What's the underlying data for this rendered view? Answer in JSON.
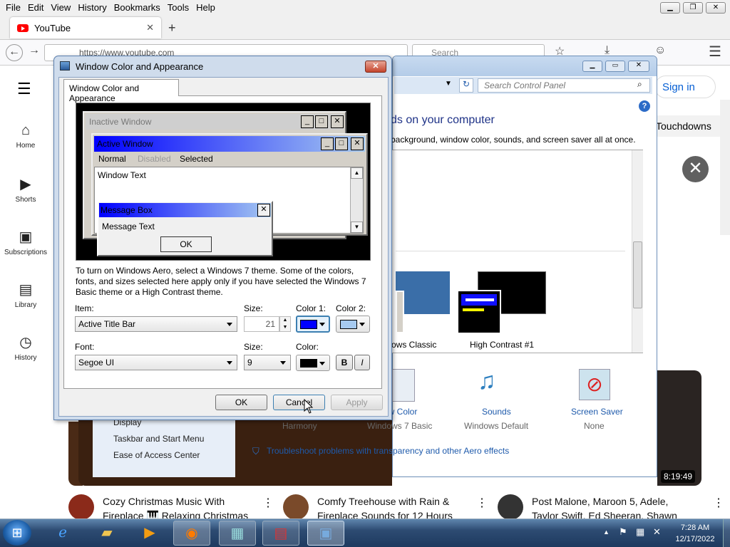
{
  "firefox": {
    "menu": [
      "File",
      "Edit",
      "View",
      "History",
      "Bookmarks",
      "Tools",
      "Help"
    ],
    "tab_title": "YouTube",
    "new_tab": "+",
    "url": "https://www.youtube.com",
    "search_placeholder": "Search"
  },
  "youtube": {
    "sidebar": [
      {
        "label": "Home",
        "icon": "home-icon"
      },
      {
        "label": "Shorts",
        "icon": "shorts-icon"
      },
      {
        "label": "Subscriptions",
        "icon": "subscriptions-icon"
      },
      {
        "label": "Library",
        "icon": "library-icon"
      },
      {
        "label": "History",
        "icon": "history-icon"
      }
    ],
    "sign_in": "Sign in",
    "chip": "Touchdowns",
    "duration": "8:19:49",
    "videos": [
      {
        "title_line1": "Cozy Christmas Music With",
        "title_line2": "Fireplace 🎹 Relaxing Christmas"
      },
      {
        "title_line1": "Comfy Treehouse with Rain &",
        "title_line2": "Fireplace Sounds for 12 Hours"
      },
      {
        "title_line1": "Post Malone, Maroon 5, Adele,",
        "title_line2": "Taylor Swift, Ed Sheeran, Shawn"
      }
    ]
  },
  "control_panel": {
    "search_placeholder": "Search Control Panel",
    "heading": "ds on your computer",
    "subheading": "background, window color, sounds, and screen saver all at once.",
    "themes": [
      {
        "label": "ows Classic"
      },
      {
        "label": "High Contrast #1"
      }
    ],
    "bottom_items": [
      {
        "title": "ow Color",
        "sub": "Windows 7 Basic"
      },
      {
        "title": "Sounds",
        "sub": "Windows Default"
      },
      {
        "title": "Screen Saver",
        "sub": "None"
      }
    ],
    "harmony": "Harmony",
    "see_also": [
      "Display",
      "Taskbar and Start Menu",
      "Ease of Access Center"
    ],
    "troubleshoot": "Troubleshoot problems with transparency and other Aero effects"
  },
  "dialog": {
    "title": "Window Color and Appearance",
    "tab": "Window Color and Appearance",
    "preview": {
      "inactive_title": "Inactive Window",
      "active_title": "Active Window",
      "menu_normal": "Normal",
      "menu_disabled": "Disabled",
      "menu_selected": "Selected",
      "window_text": "Window Text",
      "msg_title": "Message Box",
      "msg_text": "Message Text",
      "msg_ok": "OK"
    },
    "info_text": "To turn on Windows Aero, select a Windows 7 theme.  Some of the colors, fonts, and sizes selected here apply only if you have selected the Windows 7 Basic theme or a High Contrast theme.",
    "item_label": "Item:",
    "item_value": "Active Title Bar",
    "size_label": "Size:",
    "size_value": "21",
    "color1_label": "Color 1:",
    "color2_label": "Color 2:",
    "color1": "#0000ff",
    "color2": "#a6caf0",
    "font_label": "Font:",
    "font_value": "Segoe UI",
    "font_size_label": "Size:",
    "font_size_value": "9",
    "font_color_label": "Color:",
    "font_color": "#000000",
    "bold": "B",
    "italic": "I",
    "ok": "OK",
    "cancel": "Cancel",
    "apply": "Apply"
  },
  "taskbar": {
    "time": "7:28 AM",
    "date": "12/17/2022"
  }
}
